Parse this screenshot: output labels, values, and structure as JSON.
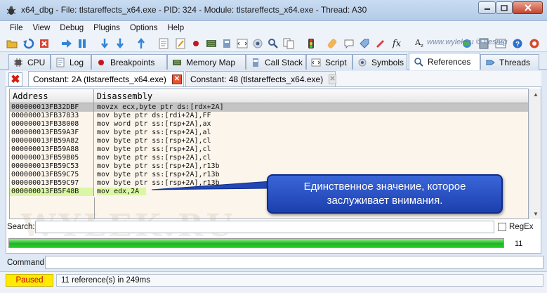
{
  "window": {
    "title": "x64_dbg - File: tlstareffects_x64.exe - PID: 324 - Module: tlstareffects_x64.exe - Thread: A30"
  },
  "menu": [
    "File",
    "View",
    "Debug",
    "Plugins",
    "Options",
    "Help"
  ],
  "watermark": "www.wylek.ru © Lesnrg",
  "watermark_bg": "WYLEK.RU",
  "tabs": [
    {
      "label": "CPU",
      "icon": "cpu-icon"
    },
    {
      "label": "Log",
      "icon": "log-icon"
    },
    {
      "label": "Breakpoints",
      "icon": "breakpoint-icon"
    },
    {
      "label": "Memory Map",
      "icon": "memory-map-icon"
    },
    {
      "label": "Call Stack",
      "icon": "call-stack-icon"
    },
    {
      "label": "Script",
      "icon": "script-icon"
    },
    {
      "label": "Symbols",
      "icon": "symbols-icon"
    },
    {
      "label": "References",
      "icon": "references-icon",
      "active": true
    },
    {
      "label": "Threads",
      "icon": "threads-icon"
    }
  ],
  "subtabs": [
    {
      "label": "Constant: 2A (tlstareffects_x64.exe)",
      "active": true
    },
    {
      "label": "Constant: 48 (tlstareffects_x64.exe)",
      "active": false
    }
  ],
  "table": {
    "columns": [
      "Address",
      "Disassembly"
    ],
    "rows": [
      {
        "address": "000000013FB32DBF",
        "disasm": "movzx ecx,byte ptr ds:[rdx+2A]",
        "state": "selected"
      },
      {
        "address": "000000013FB37833",
        "disasm": "mov byte ptr ds:[rdi+2A],FF",
        "state": ""
      },
      {
        "address": "000000013FB38008",
        "disasm": "mov word ptr ss:[rsp+2A],ax",
        "state": ""
      },
      {
        "address": "000000013FB59A3F",
        "disasm": "mov byte ptr ss:[rsp+2A],al",
        "state": ""
      },
      {
        "address": "000000013FB59A82",
        "disasm": "mov byte ptr ss:[rsp+2A],cl",
        "state": ""
      },
      {
        "address": "000000013FB59A88",
        "disasm": "mov byte ptr ss:[rsp+2A],cl",
        "state": ""
      },
      {
        "address": "000000013FB59B05",
        "disasm": "mov byte ptr ss:[rsp+2A],cl",
        "state": ""
      },
      {
        "address": "000000013FB59C53",
        "disasm": "mov byte ptr ss:[rsp+2A],r13b",
        "state": ""
      },
      {
        "address": "000000013FB59C75",
        "disasm": "mov byte ptr ss:[rsp+2A],r13b",
        "state": ""
      },
      {
        "address": "000000013FB59C97",
        "disasm": "mov byte ptr ss:[rsp+2A],r13b",
        "state": ""
      },
      {
        "address": "000000013FB5F48B",
        "disasm": "mov edx,2A",
        "state": "highlighted"
      }
    ]
  },
  "callout": {
    "line1": "Единственное значение, которое",
    "line2": "заслуживает внимания."
  },
  "search": {
    "label": "Search:",
    "value": "",
    "regex_label": "RegEx"
  },
  "progress": {
    "fraction": 1.0,
    "count": "11"
  },
  "command": {
    "label": "Command:",
    "value": ""
  },
  "status": {
    "state": "Paused",
    "message": "11 reference(s) in 249ms"
  },
  "colors": {
    "accent": "#1d3fae",
    "paused_bg": "#ffea00",
    "highlight_row": "#dbf7a5"
  }
}
